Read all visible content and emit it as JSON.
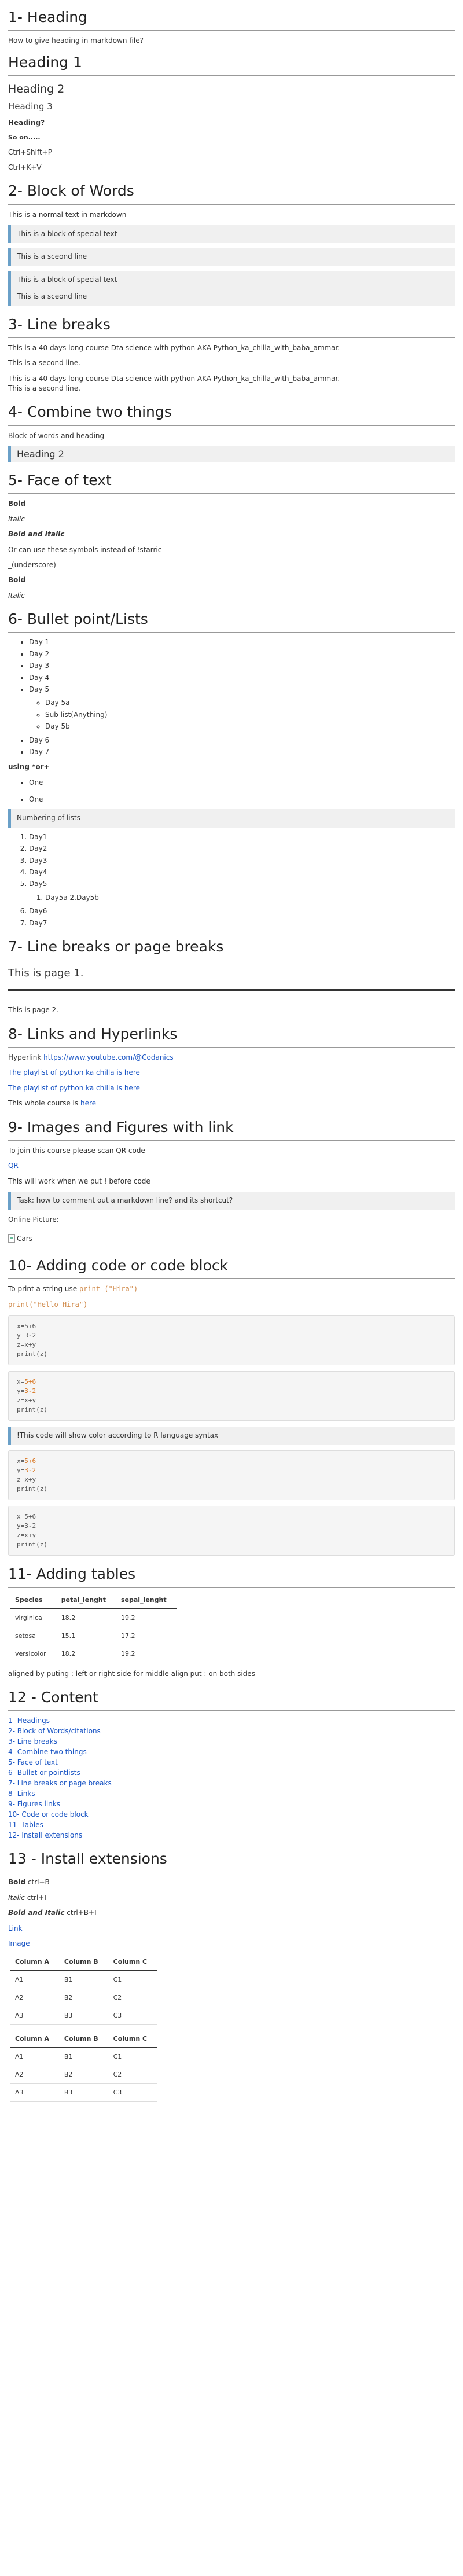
{
  "s1": {
    "title": "1- Heading",
    "intro": "How to give heading in markdown file?",
    "h1": "Heading 1",
    "h2": "Heading 2",
    "h3": "Heading 3",
    "h4": "Heading?",
    "h5": "So on.....",
    "shortcut1": "Ctrl+Shift+P",
    "shortcut2": "Ctrl+K+V"
  },
  "s2": {
    "title": "2- Block of Words",
    "normal": "This is a normal text in markdown",
    "block1": "This is a block of special text",
    "block2": "This is a sceond line",
    "block3a": "This is a block of special text",
    "block3b": "This is a sceond line"
  },
  "s3": {
    "title": "3- Line breaks",
    "l1": "This is a 40 days long course Dta science with python AKA Python_ka_chilla_with_baba_ammar.",
    "l2": "This is a second line.",
    "l3": "This is a 40 days long course Dta science with python AKA Python_ka_chilla_with_baba_ammar.",
    "l4": "This is a second line."
  },
  "s4": {
    "title": "4- Combine two things",
    "text": "Block of words and heading",
    "heading": "Heading 2"
  },
  "s5": {
    "title": "5- Face of text",
    "bold": "Bold",
    "italic": "Italic",
    "bolditalic": "Bold and Italic",
    "or": "Or can use these symbols instead of !starric",
    "underscore": "_(underscore)",
    "bold2": "Bold",
    "italic2": "Italic"
  },
  "s6": {
    "title": "6- Bullet point/Lists",
    "days": [
      "Day 1",
      "Day 2",
      "Day 3",
      "Day 4",
      "Day 5"
    ],
    "subdays": [
      "Day 5a",
      "Sub list(Anything)",
      "Day 5b"
    ],
    "days2": [
      "Day 6",
      "Day 7"
    ],
    "using": "using *or+",
    "one1": "One",
    "one2": "One",
    "numbering": "Numbering of lists",
    "num": [
      "Day1",
      "Day2",
      "Day3",
      "Day4",
      "Day5"
    ],
    "numsub": "Day5a 2.Day5b",
    "num2": [
      "Day6",
      "Day7"
    ]
  },
  "s7": {
    "title": "7- Line breaks or page breaks",
    "page1": "This is page 1.",
    "page2": "This is page 2."
  },
  "s8": {
    "title": "8- Links and Hyperlinks",
    "hyper_prefix": "Hyperlink",
    "hyper_url": "https://www.youtube.com/@Codanics",
    "link1": "The playlist of python ka chilla is here",
    "link2": "The playlist of python ka chilla is here",
    "whole_prefix": "This whole course is",
    "whole_link": "here"
  },
  "s9": {
    "title": "9- Images and Figures with link",
    "join": "To join this course please scan QR code",
    "qr": "QR",
    "work": "This will work when we put ! before code",
    "task": "Task: how to comment out a markdown line? and its shortcut?",
    "online": "Online Picture:",
    "img_alt": "Cars"
  },
  "s10": {
    "title": "10- Adding code or code block",
    "print_prefix": "To print a string use",
    "print_inline": "print (\"Hira\")",
    "print_line": "print(\"Hello Hira\")",
    "note": "!This code will show color according to R language syntax"
  },
  "s11": {
    "title": "11- Adding tables",
    "headers": [
      "Species",
      "petal_lenght",
      "sepal_lenght"
    ],
    "rows": [
      [
        "virginica",
        "18.2",
        "19.2"
      ],
      [
        "setosa",
        "15.1",
        "17.2"
      ],
      [
        "versicolor",
        "18.2",
        "19.2"
      ]
    ],
    "note": "aligned by puting : left or right side for middle align put : on both sides"
  },
  "s12": {
    "title": "12 - Content",
    "items": [
      "1- Headings",
      "2- Block of Words/citations",
      "3- Line breaks",
      "4- Combine two things",
      "5- Face of text",
      "6- Bullet or pointlists",
      "7- Line breaks or page breaks",
      "8- Links",
      "9- Figures links",
      "10- Code or code block",
      "11- Tables",
      "12- Install extensions"
    ]
  },
  "s13": {
    "title": "13 - Install extensions",
    "bold": "Bold",
    "bold_sc": "ctrl+B",
    "italic": "Italic",
    "italic_sc": "ctrl+I",
    "bi": "Bold and Italic",
    "bi_sc": "ctrl+B+I",
    "link": "Link",
    "image": "Image",
    "headers": [
      "Column A",
      "Column B",
      "Column C"
    ],
    "rows": [
      [
        "A1",
        "B1",
        "C1"
      ],
      [
        "A2",
        "B2",
        "C2"
      ],
      [
        "A3",
        "B3",
        "C3"
      ]
    ]
  }
}
